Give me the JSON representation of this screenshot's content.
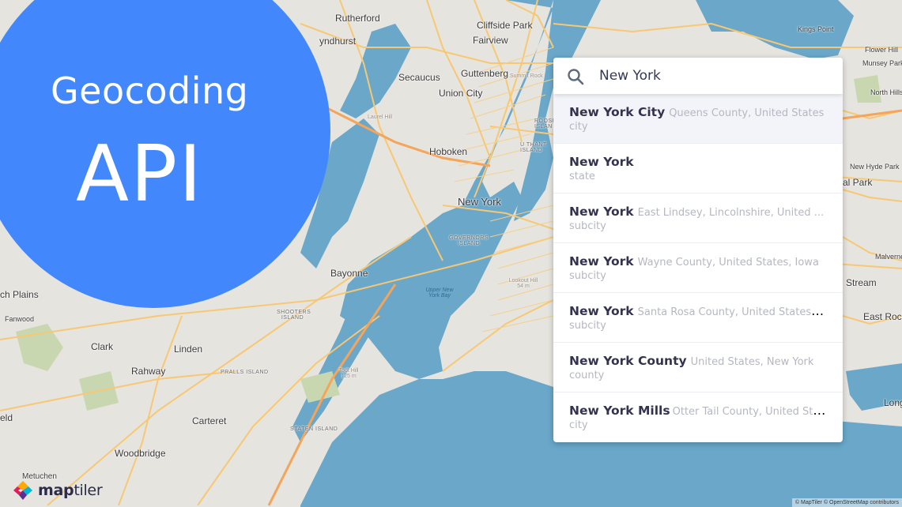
{
  "hero": {
    "subtitle": "Geocoding",
    "title": "API",
    "circle_color": "#4288fc"
  },
  "search": {
    "icon": "search-icon",
    "value": "New York",
    "placeholder": ""
  },
  "results": [
    {
      "name": "New York City",
      "context": "Queens County, United States",
      "type": "city",
      "active": true
    },
    {
      "name": "New York",
      "context": "",
      "type": "state",
      "active": false
    },
    {
      "name": "New York",
      "context": "East Lindsey, Lincolnshire, United ...",
      "type": "subcity",
      "active": false
    },
    {
      "name": "New York",
      "context": "Wayne County, United States, Iowa",
      "type": "subcity",
      "active": false
    },
    {
      "name": "New York",
      "context": "Santa Rosa County, United States, ...",
      "type": "subcity",
      "active": false
    },
    {
      "name": "New York County",
      "context": "United States, New York",
      "type": "county",
      "active": false
    },
    {
      "name": "New York Mills",
      "context": "Otter Tail County, United Sta...",
      "type": "city",
      "active": false
    }
  ],
  "map_labels": {
    "rutherford": "Rutherford",
    "lyndhurst": "yndhurst",
    "secaucus": "Secaucus",
    "cliffside_park": "Cliffside Park",
    "fairview": "Fairview",
    "guttenberg": "Guttenberg",
    "union_city": "Union City",
    "hoboken": "Hoboken",
    "new_york": "New York",
    "bayonne": "Bayonne",
    "governors_island": "GOVERNORS ISLAND",
    "upper_bay": "Upper New York Bay",
    "shooters_island": "SHOOTERS ISLAND",
    "roosevelt_island": "ROOSEV ISLAN",
    "u_thant_island": "U THANT ISLAND",
    "summit_rock": "Summit Rock",
    "laurel_hill": "Laurel Hill",
    "lookout_hill": "Lookout Hill 54 m",
    "todt_hill": "Todt Hill 125 m",
    "scotch_plains": "ch Plains",
    "fanwood": "Fanwood",
    "clark": "Clark",
    "linden": "Linden",
    "rahway": "Rahway",
    "pralls_island": "PRALLS ISLAND",
    "carteret": "Carteret",
    "staten_island": "STATEN ISLAND",
    "woodbridge": "Woodbridge",
    "metuchen": "Metuchen",
    "westfield": "eld",
    "kings_point": "Kings Point",
    "flower_hill": "Flower Hill",
    "munsey_park": "Munsey Park",
    "north_hills": "North Hills",
    "new_hyde_park": "New Hyde Park",
    "floral_park": "al Park",
    "malverne": "Malverne",
    "valley_stream": "Stream",
    "east_rockaway": "East Rock",
    "long_beach": "Long"
  },
  "logo": {
    "bold": "map",
    "light": "tiler"
  },
  "attribution": "© MapTiler © OpenStreetMap contributors"
}
